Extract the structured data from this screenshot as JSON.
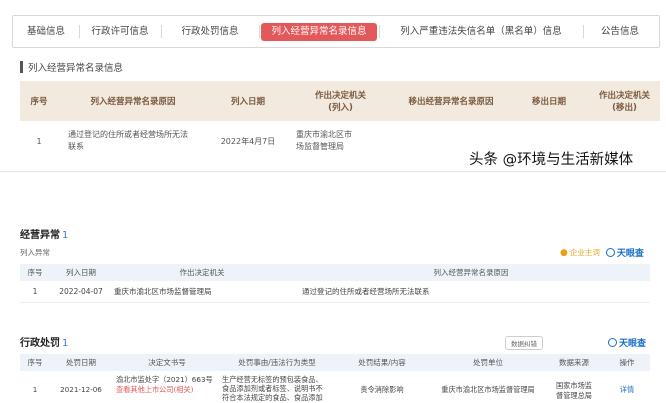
{
  "top": {
    "tabs": [
      {
        "label": "基础信息",
        "active": false
      },
      {
        "label": "行政许可信息",
        "active": false
      },
      {
        "label": "行政处罚信息",
        "active": false
      },
      {
        "label": "列入经营异常名录信息",
        "active": true
      },
      {
        "label": "列入严重违法失信名单（黑名单）信息",
        "active": false
      },
      {
        "label": "公告信息",
        "active": false
      }
    ],
    "section_title": "列入经营异常名录信息",
    "table": {
      "headers": [
        "序号",
        "列入经营异常名录原因",
        "列入日期",
        "作出决定机关（列入）",
        "移出经营异常名录原因",
        "移出日期",
        "作出决定机关（移出）"
      ],
      "header_lines": [
        [
          "序号"
        ],
        [
          "列入经营异常名录原因"
        ],
        [
          "列入日期"
        ],
        [
          "作出决定机关",
          "(列入)"
        ],
        [
          "移出经营异常名录原因"
        ],
        [
          "移出日期"
        ],
        [
          "作出决定机关",
          "(移出)"
        ]
      ],
      "rows": [
        {
          "no": "1",
          "reason_l1": "通过登记的住所或者经营场所无法",
          "reason_l2": "联系",
          "date": "2022年4月7日",
          "authority_l1": "重庆市渝北区市",
          "authority_l2": "场监督管理局",
          "remove_reason": "",
          "remove_date": "",
          "remove_authority": ""
        }
      ]
    },
    "watermark": "头条 @环境与生活新媒体"
  },
  "bottom": {
    "abnormal": {
      "title": "经营异常",
      "count": "1",
      "subtitle": "列入异常",
      "subscribe": "企业主词",
      "brand": "天眼查",
      "headers": [
        "序号",
        "列入日期",
        "作出决定机关",
        "列入经营异常名录原因"
      ],
      "rows": [
        {
          "no": "1",
          "date": "2022-04-07",
          "authority": "重庆市渝北区市场监督管理局",
          "reason": "通过登记的住所或者经营场所无法联系"
        }
      ]
    },
    "penalty": {
      "title": "行政处罚",
      "count": "1",
      "chip": "数据纠错",
      "brand": "天眼查",
      "headers": [
        "序号",
        "处罚日期",
        "决定文书号",
        "处罚事由/违法行为类型",
        "处罚结果/内容",
        "处罚单位",
        "数据来源",
        "操作"
      ],
      "rows": [
        {
          "no": "1",
          "date": "2021-12-06",
          "doc_l1": "渝北市监处字（2021）663号",
          "doc_l2": "查看其他上市公司(相关)",
          "reason_l1": "生产经营无标签的预包装食品、",
          "reason_l2": "食品添加剂或者标签、说明书不",
          "reason_l3": "符合本法规定的食品、食品添加",
          "result": "责令消除影响",
          "unit": "重庆市渝北区市场监督管理局",
          "source_l1": "国家市场监",
          "source_l2": "督管理总局",
          "action": "详情"
        }
      ]
    }
  }
}
